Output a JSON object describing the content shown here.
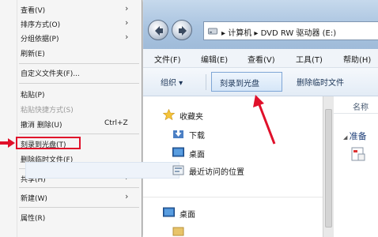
{
  "context_menu": {
    "items": [
      {
        "label": "查看(V)",
        "has_submenu": true
      },
      {
        "label": "排序方式(O)",
        "has_submenu": true
      },
      {
        "label": "分组依据(P)",
        "has_submenu": true
      },
      {
        "label": "刷新(E)"
      },
      {
        "label": "自定义文件夹(F)..."
      },
      {
        "label": "粘贴(P)"
      },
      {
        "label": "粘贴快捷方式(S)",
        "disabled": true
      },
      {
        "label": "撤消 删除(U)",
        "shortcut": "Ctrl+Z"
      },
      {
        "label": "刻录到光盘(T)",
        "highlighted": true
      },
      {
        "label": "删除临时文件(F)"
      },
      {
        "label": "共享(H)",
        "has_submenu": true
      },
      {
        "label": "新建(W)",
        "has_submenu": true
      },
      {
        "label": "属性(R)"
      }
    ]
  },
  "explorer": {
    "address": {
      "separator": "▸",
      "segment1": "计算机",
      "segment2": "DVD RW 驱动器 (E:)"
    },
    "menubar": [
      "文件(F)",
      "编辑(E)",
      "查看(V)",
      "工具(T)",
      "帮助(H)"
    ],
    "toolbar": {
      "organize": "组织 ▾",
      "burn": "刻录到光盘",
      "delete_temp": "删除临时文件"
    },
    "nav": {
      "favorites": "收藏夹",
      "downloads": "下载",
      "desktop": "桌面",
      "recent": "最近访问的位置",
      "desktop_root": "桌面"
    },
    "content": {
      "column_name": "名称",
      "group_label": "准备"
    }
  },
  "colors": {
    "highlight_red": "#e0102a",
    "toolbar_blue": "#d5e6f8",
    "titlebar_blue": "#aac4e0"
  }
}
